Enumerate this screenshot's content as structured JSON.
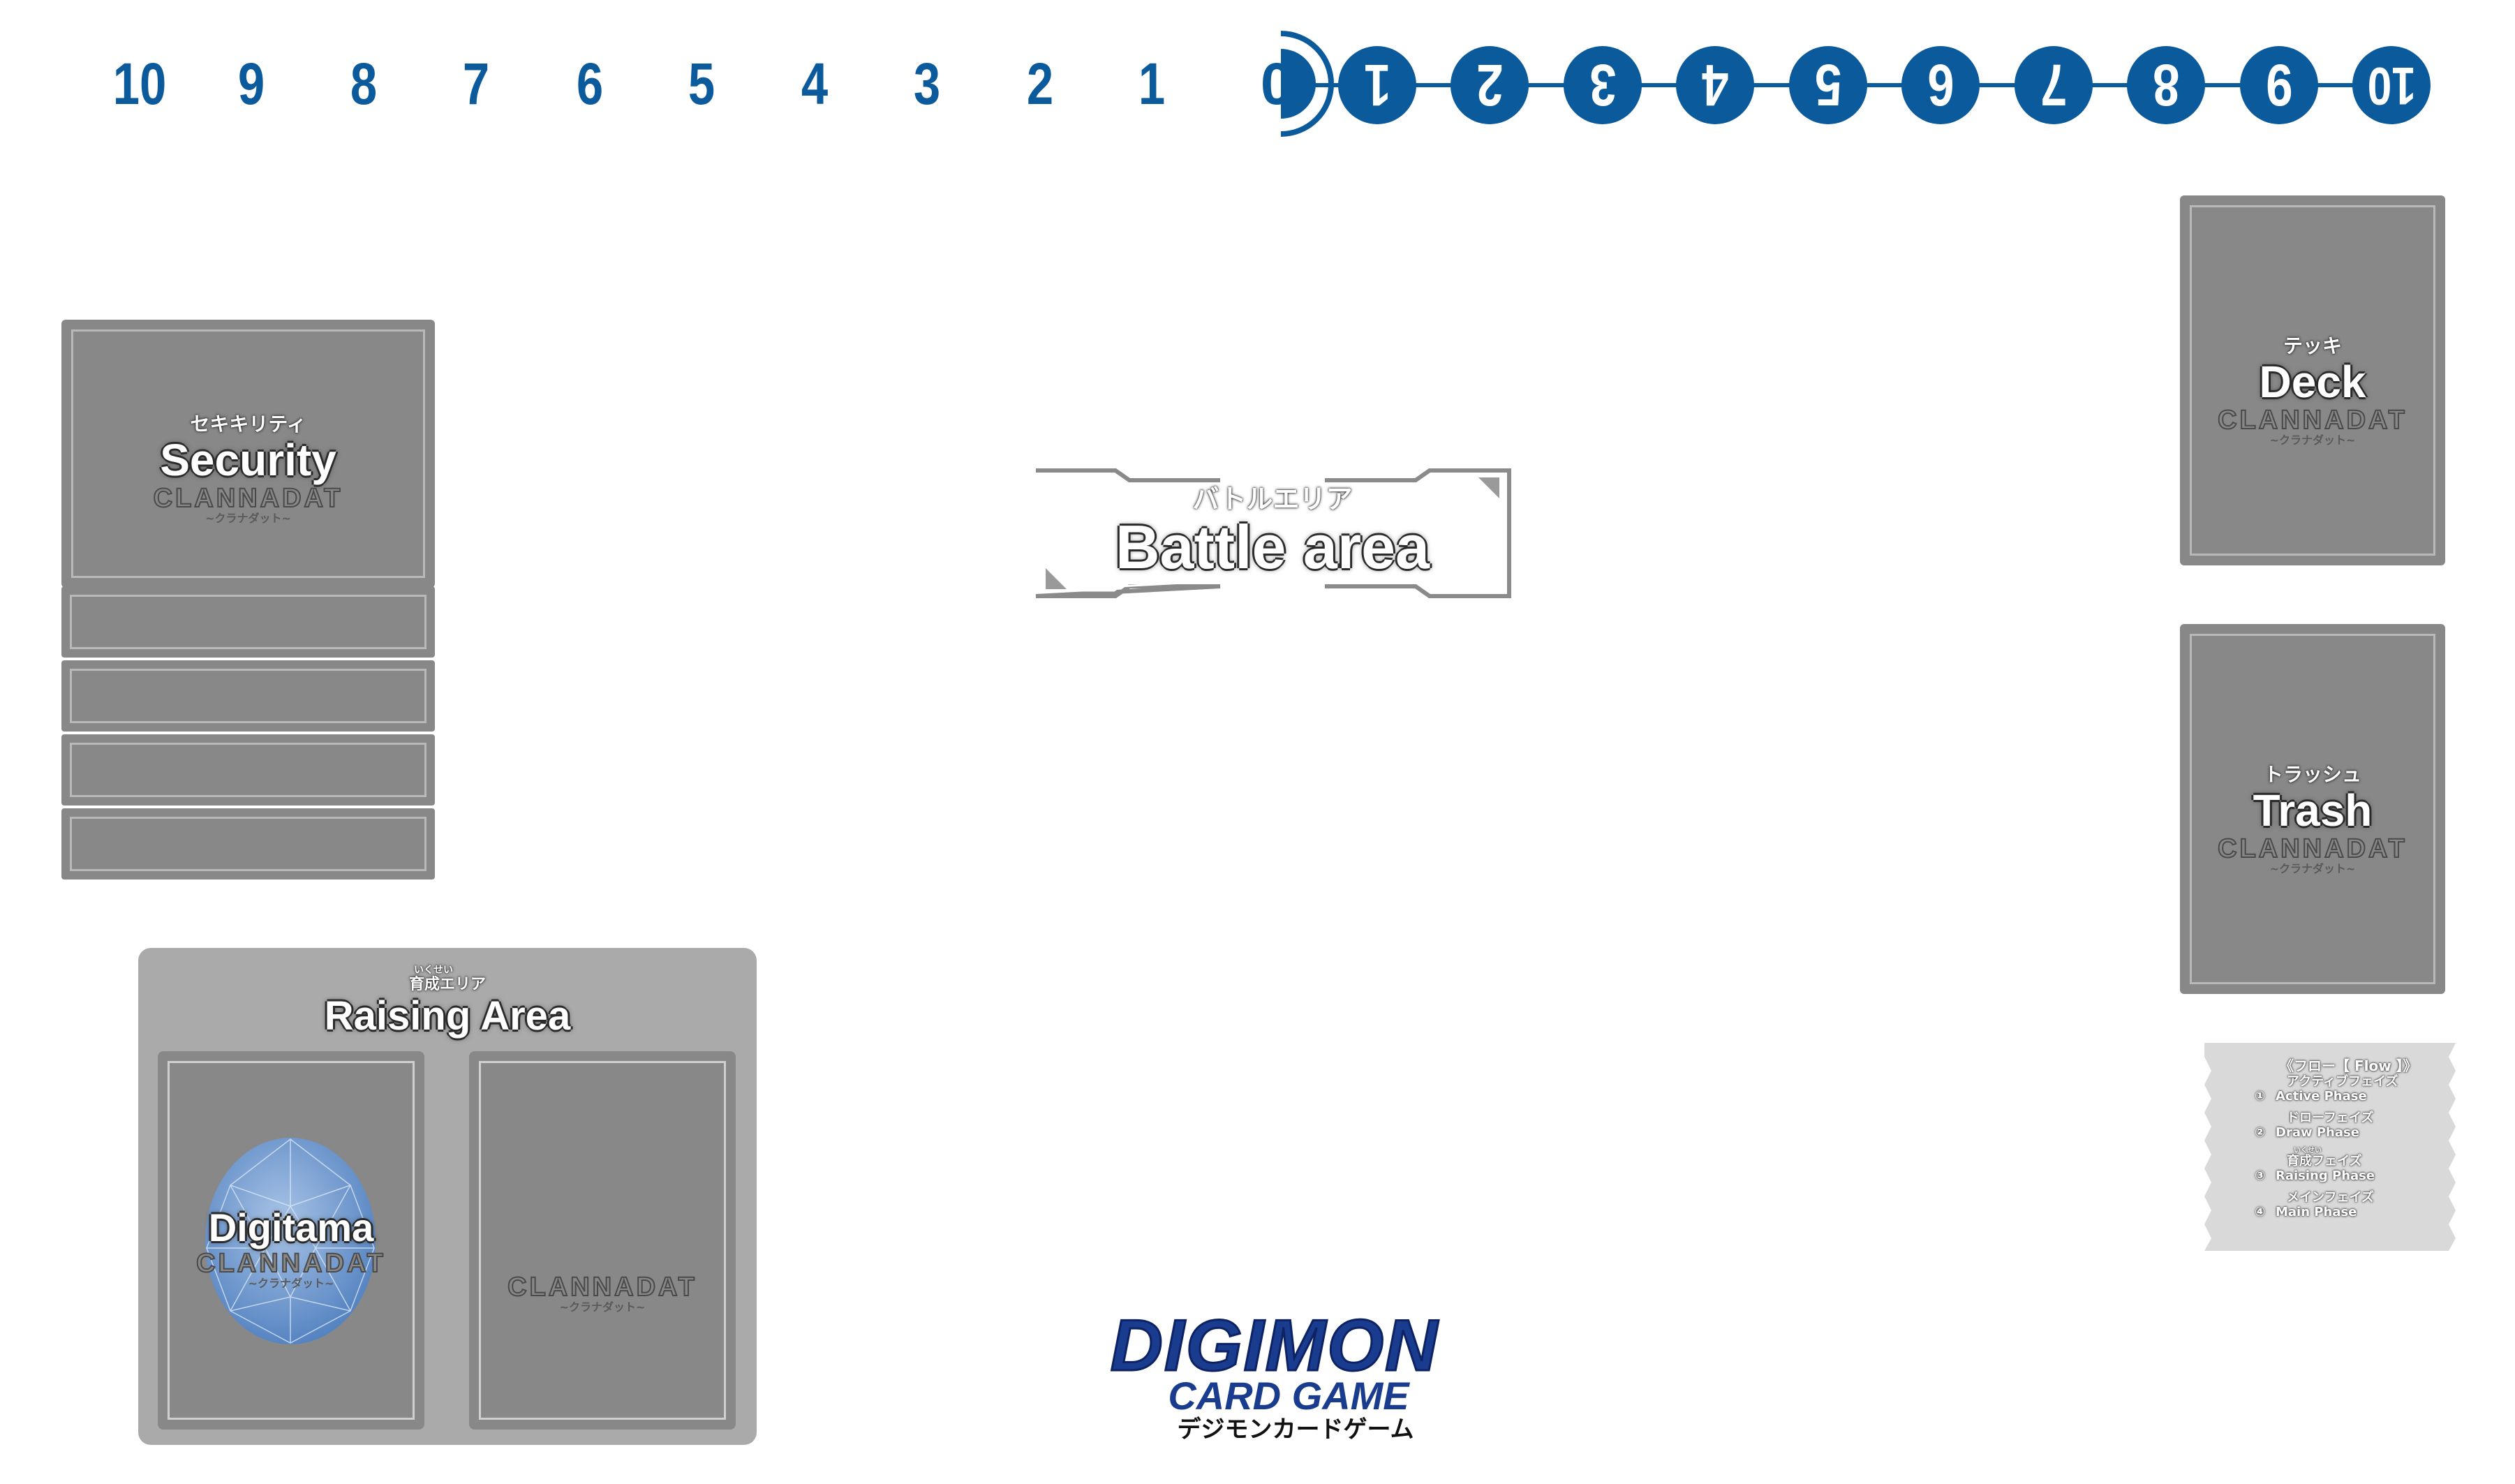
{
  "memory_gauge": {
    "left_numbers": [
      "10",
      "9",
      "8",
      "7",
      "6",
      "5",
      "4",
      "3",
      "2",
      "1"
    ],
    "zero": "0",
    "right_numbers": [
      "1",
      "2",
      "3",
      "4",
      "5",
      "6",
      "7",
      "8",
      "9",
      "10"
    ],
    "accent_color": "#0b5a9c"
  },
  "security": {
    "furigana": "セキキリティ",
    "title": "Security",
    "brand": "CLANNADAT",
    "brand_sub": "~クラナダット~"
  },
  "battle_area": {
    "furigana": "バトルエリア",
    "title": "Battle area"
  },
  "deck": {
    "furigana": "テッキ",
    "title": "Deck",
    "brand": "CLANNADAT",
    "brand_sub": "~クラナダット~"
  },
  "trash": {
    "furigana": "トラッシュ",
    "title": "Trash",
    "brand": "CLANNADAT",
    "brand_sub": "~クラナダット~"
  },
  "raising_area": {
    "ruby": "いくせい",
    "furigana": "育成エリア",
    "title": "Raising Area",
    "digitama_title": "Digitama",
    "brand": "CLANNADAT",
    "brand_sub": "~クラナダット~",
    "icon": "digitama-egg-icon"
  },
  "flow": {
    "heading": "《フロー【 Flow 】》",
    "steps": [
      {
        "num": "①",
        "jp": "アクティブフェイズ",
        "en": "Active Phase"
      },
      {
        "num": "②",
        "jp": "ドローフェイズ",
        "en": "Draw Phase"
      },
      {
        "num": "③",
        "ruby": "いくせい",
        "jp": "育成フェイズ",
        "en": "Raising Phase"
      },
      {
        "num": "④",
        "jp": "メインフェイズ",
        "en": "Main Phase"
      }
    ]
  },
  "logo": {
    "main": "DIGIMON",
    "sub": "CARD GAME",
    "jp": "デジモンカードゲーム",
    "color": "#1a3c8f"
  }
}
